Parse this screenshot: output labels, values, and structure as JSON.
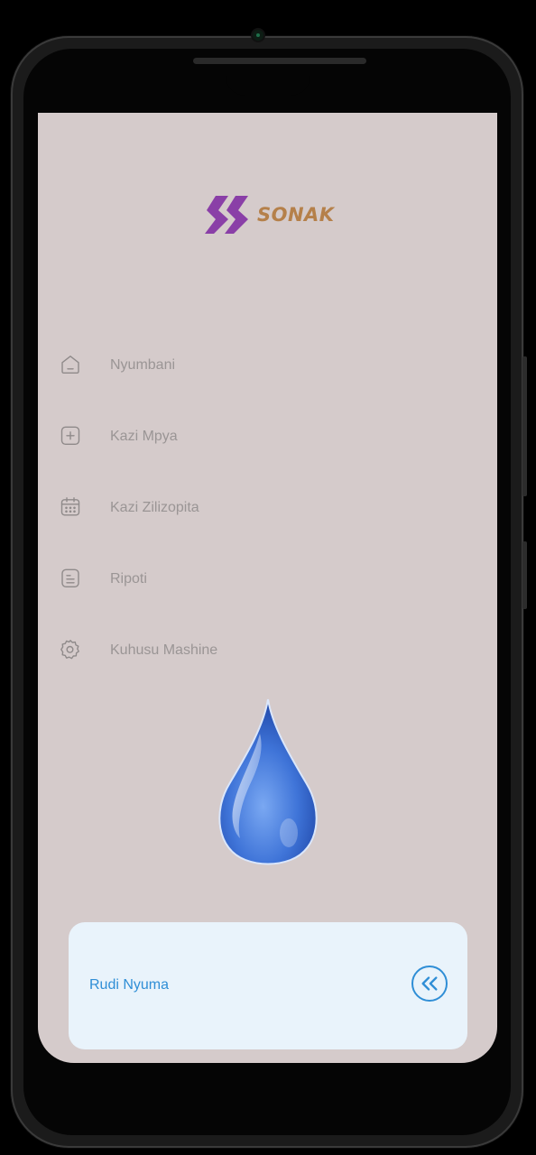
{
  "app": {
    "brand_name": "SONAK",
    "logo_icon": "sonak-logo-icon",
    "brand_color": "#b5804a",
    "logo_icon_color": "#8a3fa7"
  },
  "menu": {
    "items": [
      {
        "label": "Nyumbani",
        "icon": "home-icon"
      },
      {
        "label": "Kazi Mpya",
        "icon": "plus-square-icon"
      },
      {
        "label": "Kazi Zilizopita",
        "icon": "calendar-icon"
      },
      {
        "label": "Ripoti",
        "icon": "document-icon"
      },
      {
        "label": "Kuhusu Mashine",
        "icon": "gear-icon"
      }
    ],
    "label_color": "#9a9595"
  },
  "illustration": {
    "name": "water-drop-illustration",
    "color": "#3f74d8"
  },
  "footer": {
    "back_label": "Rudi Nyuma",
    "back_icon": "chevrons-left-icon",
    "accent": "#2f8ed6",
    "card_bg": "#e9f3fb"
  },
  "theme": {
    "screen_bg": "#d5cbcb"
  }
}
